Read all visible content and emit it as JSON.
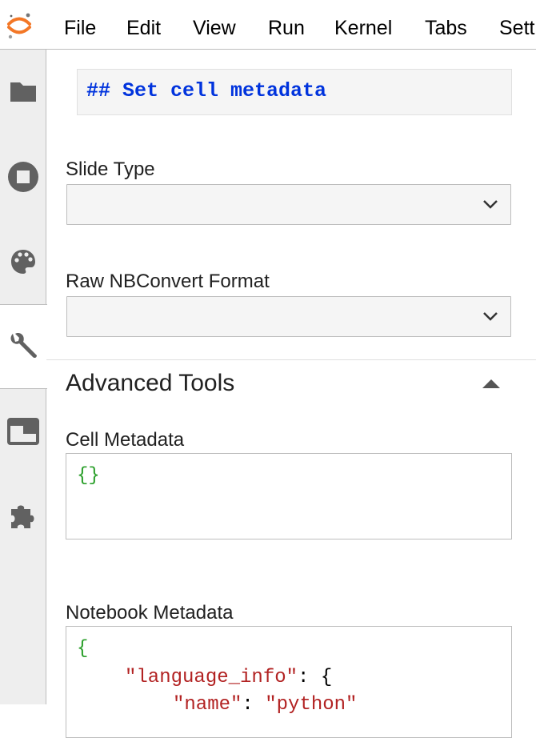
{
  "menubar": {
    "items": [
      "File",
      "Edit",
      "View",
      "Run",
      "Kernel",
      "Tabs",
      "Sett"
    ]
  },
  "sidebar": {
    "tabs": [
      {
        "icon": "folder-icon",
        "active": false
      },
      {
        "icon": "stop-circle-icon",
        "active": false
      },
      {
        "icon": "palette-icon",
        "active": false
      },
      {
        "icon": "wrench-icon",
        "active": true
      },
      {
        "icon": "tab-window-icon",
        "active": false
      },
      {
        "icon": "puzzle-icon",
        "active": false
      }
    ]
  },
  "main": {
    "cell_preview": "## Set cell metadata",
    "slide_type": {
      "label": "Slide Type",
      "value": ""
    },
    "raw_format": {
      "label": "Raw NBConvert Format",
      "value": ""
    },
    "advanced": {
      "title": "Advanced Tools",
      "cell_metadata": {
        "label": "Cell Metadata",
        "content": "{}"
      },
      "notebook_metadata": {
        "label": "Notebook Metadata",
        "open_brace": "{",
        "key1": "\"language_info\"",
        "colon1": ": {",
        "key2": "\"name\"",
        "colon2": ": ",
        "value2": "\"python\""
      }
    }
  },
  "colors": {
    "markdown_blue": "#0033dd",
    "json_brace_green": "#2ca02c",
    "json_string_red": "#b22222",
    "jupyter_orange": "#f37726"
  }
}
